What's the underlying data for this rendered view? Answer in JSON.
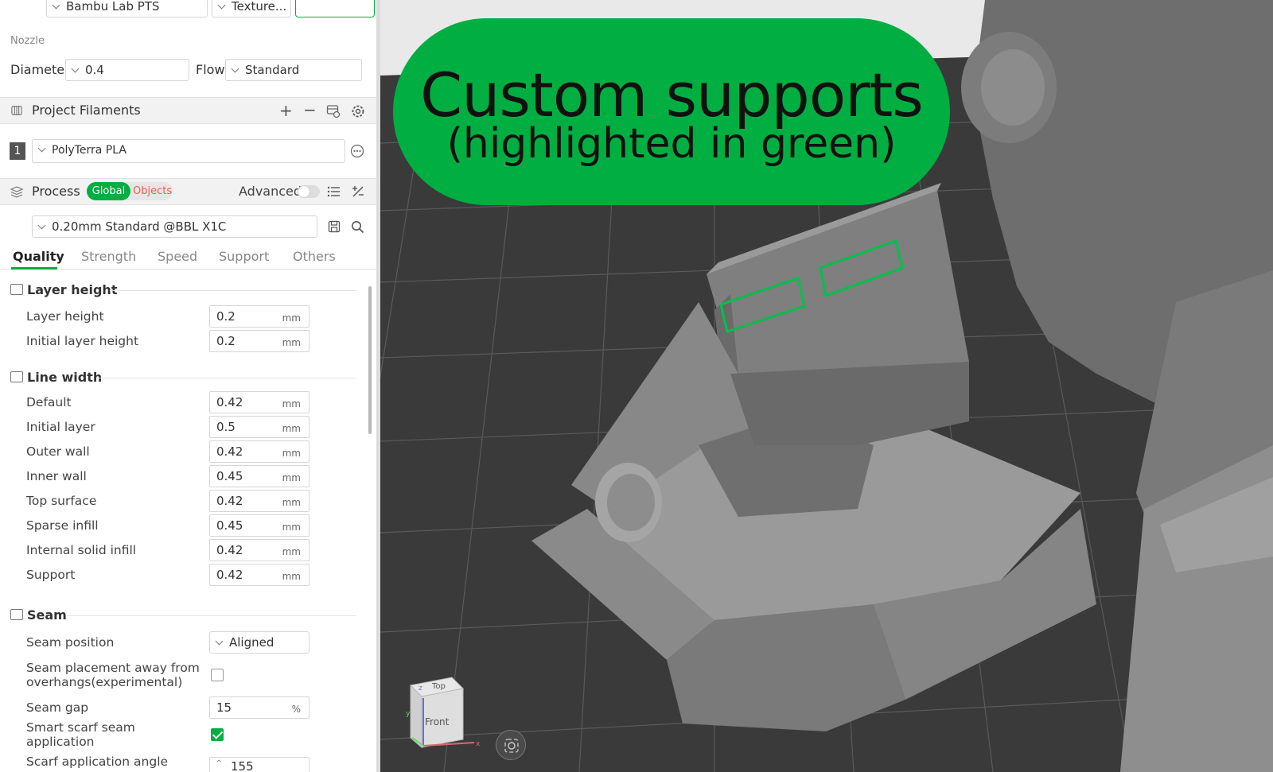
{
  "printer": {
    "plate_label": "Bambu Lab PTS",
    "plate_type_label": "Texture..."
  },
  "nozzle": {
    "section_label": "Nozzle",
    "diameter_label": "Diameter",
    "diameter_value": "0.4",
    "flow_label": "Flow",
    "flow_value": "Standard"
  },
  "filaments": {
    "title": "Project Filaments",
    "slot_number": "1",
    "filament_name": "PolyTerra PLA"
  },
  "process": {
    "title": "Process",
    "scope_global": "Global",
    "scope_objects": "Objects",
    "advanced_label": "Advanced",
    "preset": "0.20mm Standard @BBL X1C"
  },
  "tabs": [
    "Quality",
    "Strength",
    "Speed",
    "Support",
    "Others"
  ],
  "groups": {
    "layer_height": {
      "title": "Layer height",
      "rows": [
        {
          "label": "Layer height",
          "value": "0.2",
          "unit": "mm"
        },
        {
          "label": "Initial layer height",
          "value": "0.2",
          "unit": "mm"
        }
      ]
    },
    "line_width": {
      "title": "Line width",
      "rows": [
        {
          "label": "Default",
          "value": "0.42",
          "unit": "mm"
        },
        {
          "label": "Initial layer",
          "value": "0.5",
          "unit": "mm"
        },
        {
          "label": "Outer wall",
          "value": "0.42",
          "unit": "mm"
        },
        {
          "label": "Inner wall",
          "value": "0.45",
          "unit": "mm"
        },
        {
          "label": "Top surface",
          "value": "0.42",
          "unit": "mm"
        },
        {
          "label": "Sparse infill",
          "value": "0.45",
          "unit": "mm"
        },
        {
          "label": "Internal solid infill",
          "value": "0.42",
          "unit": "mm"
        },
        {
          "label": "Support",
          "value": "0.42",
          "unit": "mm"
        }
      ]
    },
    "seam": {
      "title": "Seam",
      "position_label": "Seam position",
      "position_value": "Aligned",
      "away_label_1": "Seam placement away from",
      "away_label_2": "overhangs(experimental)",
      "gap_label": "Seam gap",
      "gap_value": "15",
      "gap_unit": "%",
      "scarf_label_1": "Smart scarf seam",
      "scarf_label_2": "application",
      "scarf_angle_label": "Scarf application angle",
      "scarf_angle_value": "155"
    }
  },
  "viewport": {
    "callout_title": "Custom supports",
    "callout_subtitle": "(highlighted in green)",
    "cube_top": "Top",
    "cube_front": "Front",
    "axis_z": "z",
    "axis_y": "y",
    "axis_x": "x"
  },
  "colors": {
    "accent": "#00ae42",
    "bed": "#3a3a3a",
    "model": "#8a8a8a"
  }
}
